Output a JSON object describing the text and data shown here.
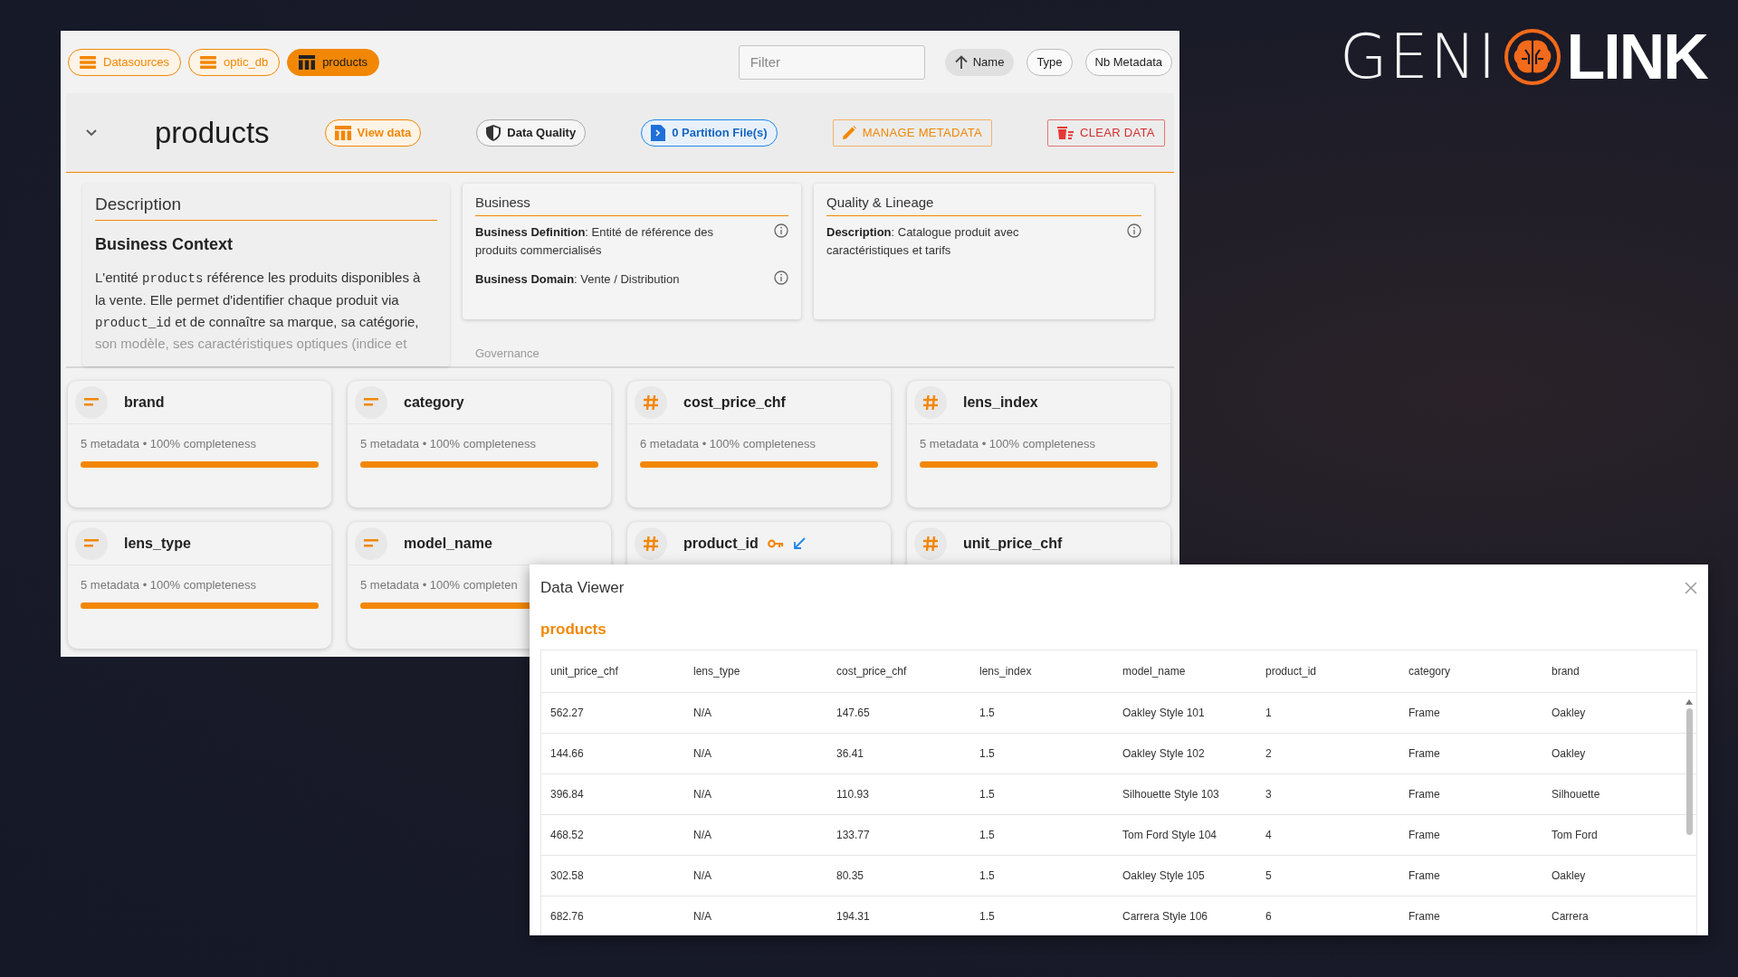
{
  "logo": {
    "light_text": "GENI",
    "bold_text": "LINK"
  },
  "breadcrumbs": [
    {
      "label": "Datasources",
      "kind": "list",
      "selected": false
    },
    {
      "label": "optic_db",
      "kind": "list",
      "selected": false
    },
    {
      "label": "products",
      "kind": "table",
      "selected": true
    }
  ],
  "filter": {
    "placeholder": "Filter"
  },
  "sort_buttons": [
    {
      "label": "Name",
      "selected": true
    },
    {
      "label": "Type",
      "selected": false
    },
    {
      "label": "Nb Metadata",
      "selected": false
    }
  ],
  "entity": {
    "title": "products",
    "expanded": true,
    "actions": [
      {
        "label": "View data",
        "kind": "view"
      },
      {
        "label": "Data Quality",
        "kind": "quality"
      },
      {
        "label": "0 Partition File(s)",
        "kind": "partition"
      },
      {
        "label": "MANAGE METADATA",
        "kind": "manage"
      },
      {
        "label": "CLEAR DATA",
        "kind": "clear"
      }
    ]
  },
  "description": {
    "title": "Description",
    "subtitle": "Business Context",
    "paragraph": [
      {
        "kind": "text",
        "text": "L'entité "
      },
      {
        "kind": "code",
        "text": "products"
      },
      {
        "kind": "text",
        "text": " référence les produits disponibles à la vente. Elle permet d'identifier chaque produit via "
      },
      {
        "kind": "code",
        "text": "product_id"
      },
      {
        "kind": "text",
        "text": " et de connaître sa marque, sa catégorie,"
      }
    ],
    "continuation": "son modèle, ses caractéristiques optiques (indice et"
  },
  "business": {
    "title": "Business",
    "fields": [
      {
        "text": "**Business Definition**: Entité de référence des produits commercialisés"
      },
      {
        "text": "**Business Domain**: Vente / Distribution"
      }
    ]
  },
  "governance": {
    "title": "Governance"
  },
  "quality": {
    "title": "Quality & Lineage",
    "fields": [
      {
        "text": "**Description**: Catalogue produit avec caractéristiques et tarifs"
      }
    ]
  },
  "columns": [
    {
      "name": "brand",
      "kind": "text",
      "meta": "5 metadata • 100% completeness",
      "level": 1
    },
    {
      "name": "category",
      "kind": "text",
      "meta": "5 metadata • 100% completeness",
      "level": 1
    },
    {
      "name": "cost_price_chf",
      "kind": "number",
      "meta": "6 metadata • 100% completeness",
      "level": 1
    },
    {
      "name": "lens_index",
      "kind": "number",
      "meta": "5 metadata • 100% completeness",
      "level": 1
    },
    {
      "name": "lens_type",
      "kind": "text",
      "meta": "5 metadata • 100% completeness",
      "level": 1
    },
    {
      "name": "model_name",
      "kind": "text",
      "meta": "5 metadata • 100% completen",
      "level": 1
    },
    {
      "name": "product_id",
      "kind": "number",
      "key": true,
      "link": true
    },
    {
      "name": "unit_price_chf",
      "kind": "number"
    }
  ],
  "data_viewer": {
    "title": "Data Viewer",
    "subtitle": "products",
    "columns": [
      "unit_price_chf",
      "lens_type",
      "cost_price_chf",
      "lens_index",
      "model_name",
      "product_id",
      "category",
      "brand"
    ],
    "rows": [
      [
        "562.27",
        "N/A",
        "147.65",
        "1.5",
        "Oakley Style 101",
        "1",
        "Frame",
        "Oakley"
      ],
      [
        "144.66",
        "N/A",
        "36.41",
        "1.5",
        "Oakley Style 102",
        "2",
        "Frame",
        "Oakley"
      ],
      [
        "396.84",
        "N/A",
        "110.93",
        "1.5",
        "Silhouette Style 103",
        "3",
        "Frame",
        "Silhouette"
      ],
      [
        "468.52",
        "N/A",
        "133.77",
        "1.5",
        "Tom Ford Style 104",
        "4",
        "Frame",
        "Tom Ford"
      ],
      [
        "302.58",
        "N/A",
        "80.35",
        "1.5",
        "Oakley Style 105",
        "5",
        "Frame",
        "Oakley"
      ],
      [
        "682.76",
        "N/A",
        "194.31",
        "1.5",
        "Carrera Style 106",
        "6",
        "Frame",
        "Carrera"
      ]
    ]
  }
}
